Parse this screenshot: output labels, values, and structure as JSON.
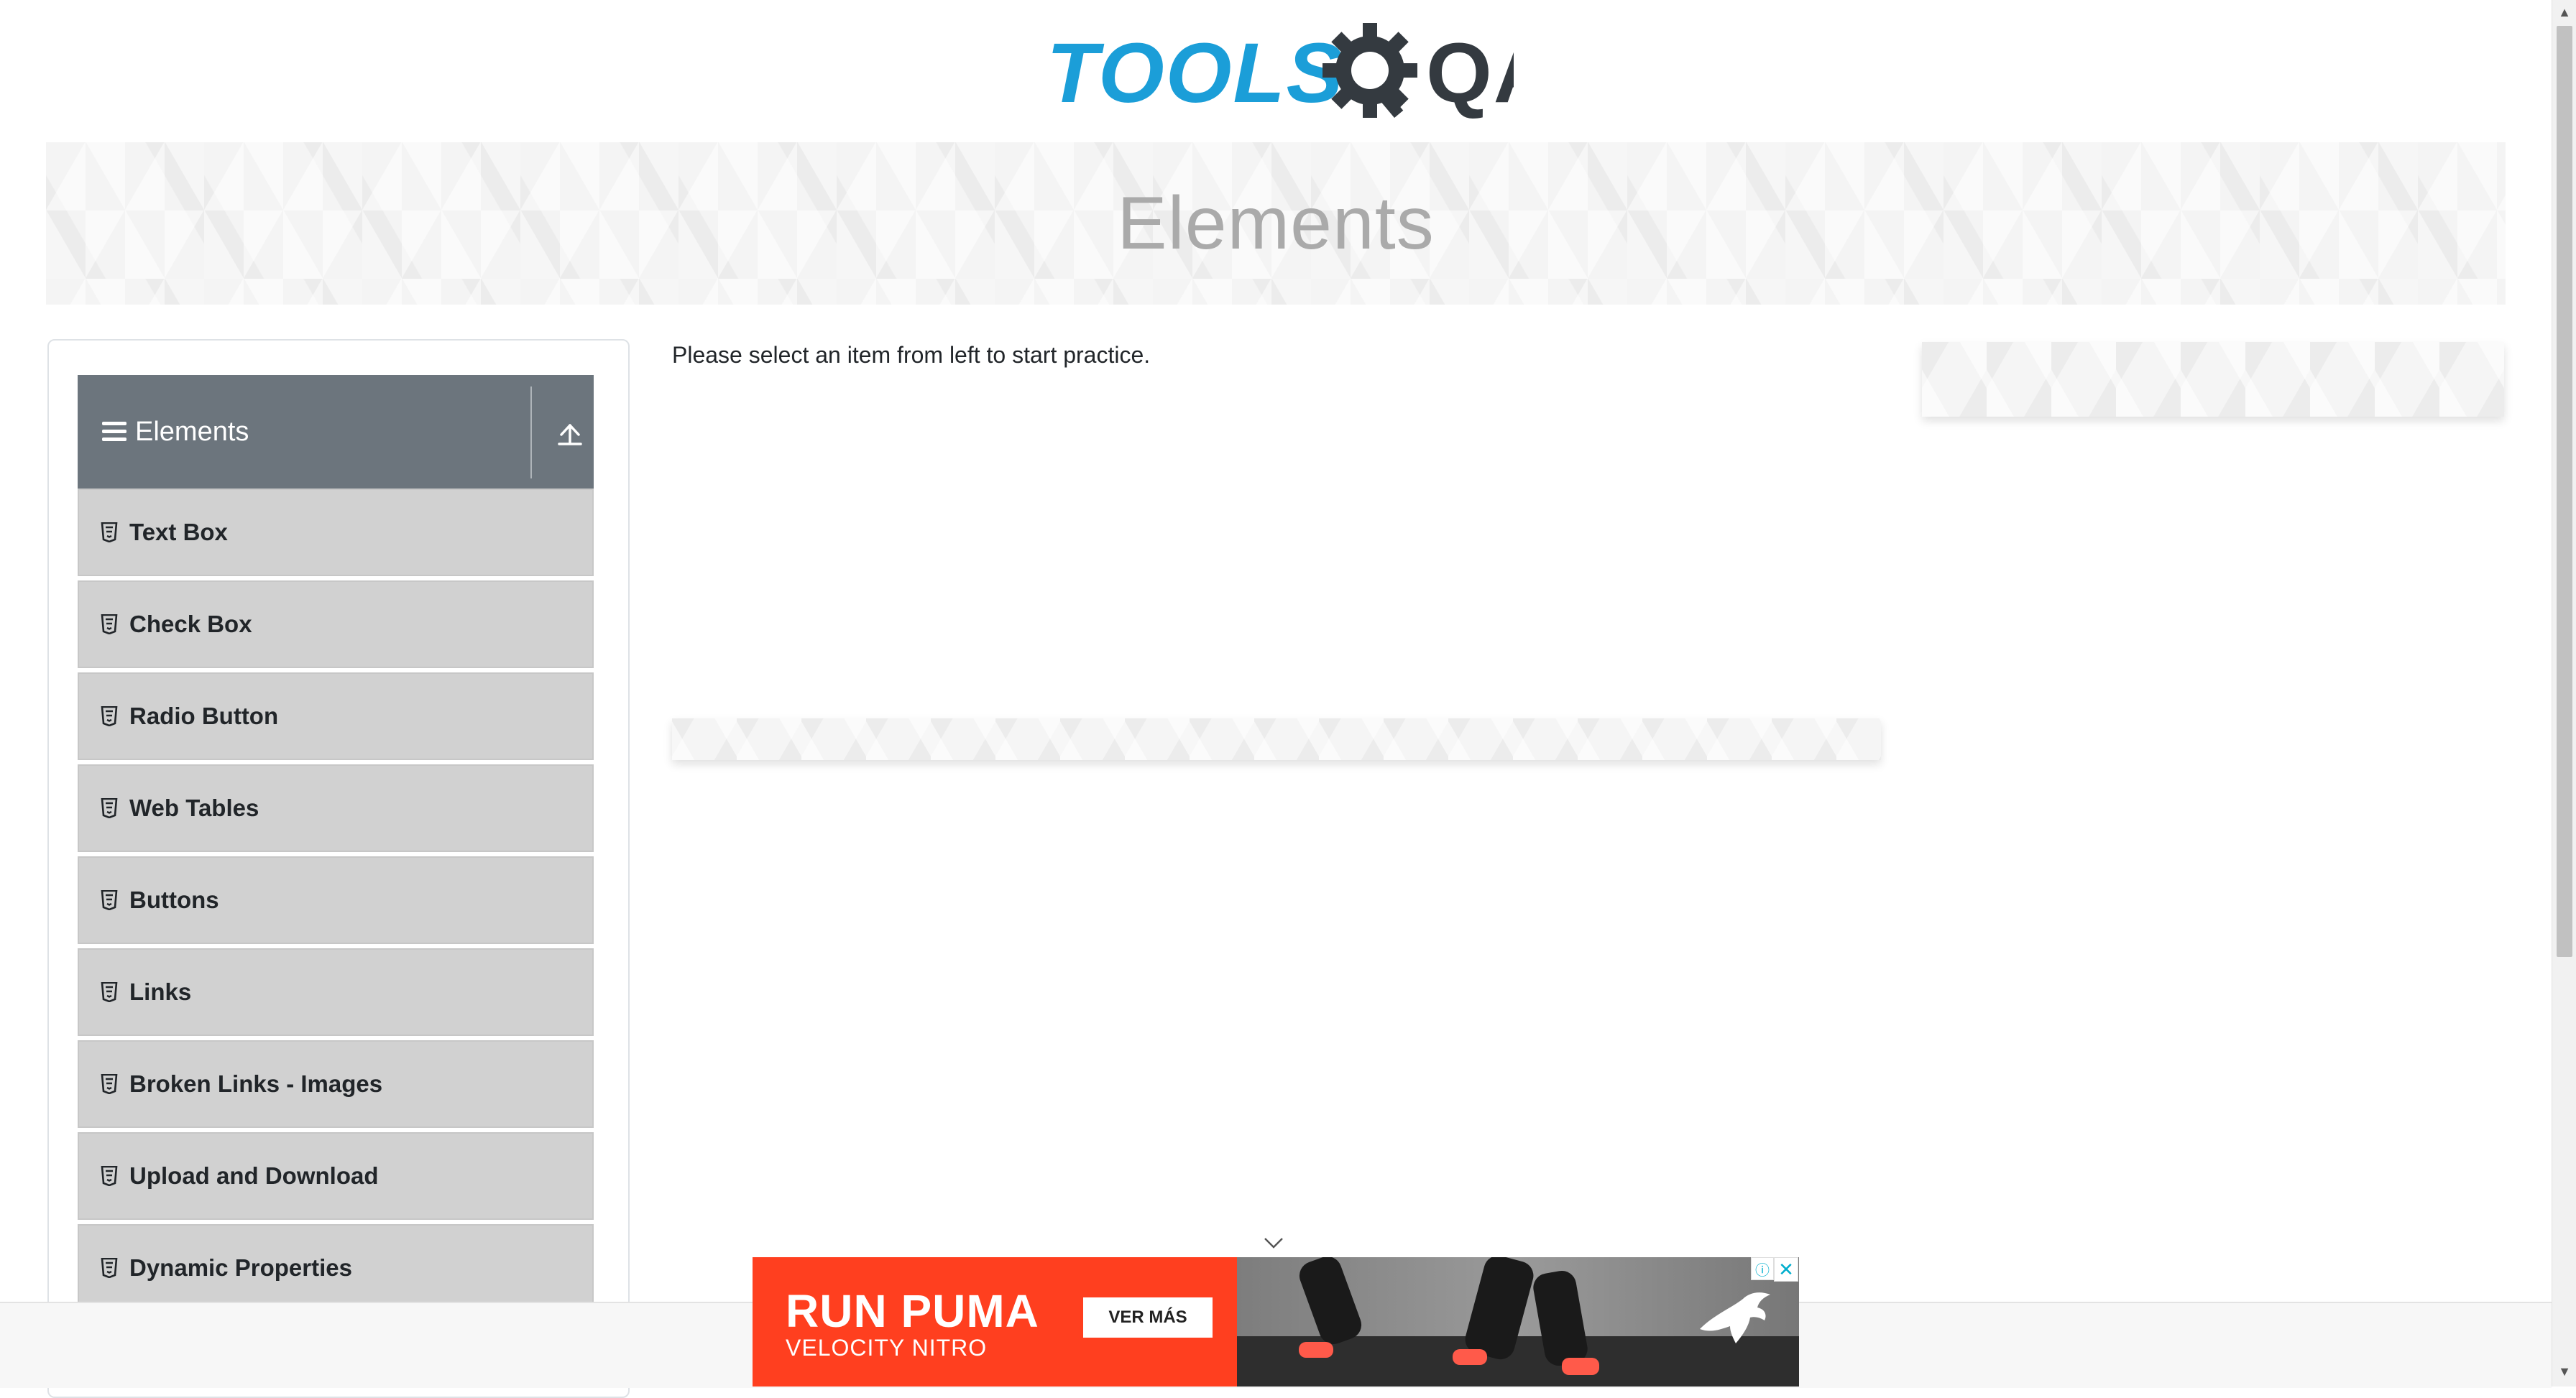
{
  "header": {
    "logo_text": "TOOLS",
    "logo_suffix": "QA"
  },
  "banner": {
    "title": "Elements"
  },
  "sidebar": {
    "group_title": "Elements",
    "items": [
      {
        "label": "Text Box"
      },
      {
        "label": "Check Box"
      },
      {
        "label": "Radio Button"
      },
      {
        "label": "Web Tables"
      },
      {
        "label": "Buttons"
      },
      {
        "label": "Links"
      },
      {
        "label": "Broken Links - Images"
      },
      {
        "label": "Upload and Download"
      },
      {
        "label": "Dynamic Properties"
      }
    ]
  },
  "main": {
    "prompt": "Please select an item from left to start practice."
  },
  "ad": {
    "headline": "RUN PUMA",
    "subline": "VELOCITY NITRO",
    "cta": "VER MÁS"
  },
  "colors": {
    "brand_blue": "#1b9ed8",
    "header_gray": "#6c757d",
    "menu_gray": "#d1d1d1",
    "ad_orange": "#ff3f1f"
  },
  "icons": {
    "menu_item": "html5-icon",
    "group": "hamburger-icon",
    "collapse": "upload-arrow-icon"
  }
}
